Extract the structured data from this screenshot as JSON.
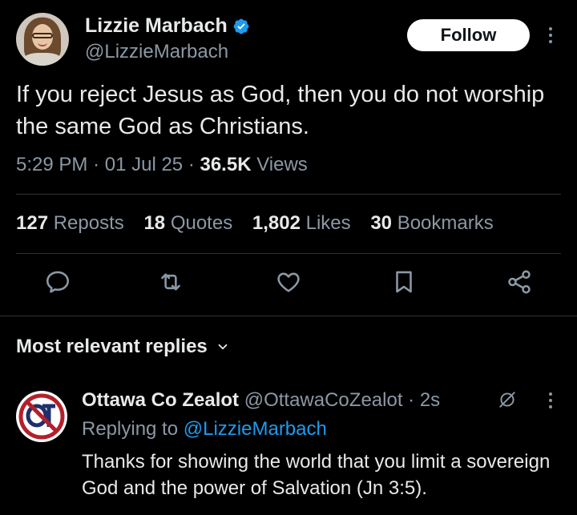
{
  "tweet": {
    "author_name": "Lizzie Marbach",
    "author_handle": "@LizzieMarbach",
    "follow_label": "Follow",
    "text": "If you reject Jesus as God, then you do not worship the same God as Christians.",
    "time": "5:29 PM",
    "date": "01 Jul 25",
    "views_count": "36.5K",
    "views_label": "Views"
  },
  "stats": {
    "reposts_count": "127",
    "reposts_label": "Reposts",
    "quotes_count": "18",
    "quotes_label": "Quotes",
    "likes_count": "1,802",
    "likes_label": "Likes",
    "bookmarks_count": "30",
    "bookmarks_label": "Bookmarks"
  },
  "icons": {
    "verified": "verified-badge-icon",
    "more": "more-vertical-icon",
    "actions": [
      "reply-icon",
      "repost-icon",
      "like-icon",
      "bookmark-icon",
      "share-icon"
    ],
    "dropdown": "chevron-down-icon",
    "grok": "grok-icon"
  },
  "replies": {
    "sort_label": "Most relevant replies",
    "items": [
      {
        "name": "Ottawa Co Zealot",
        "handle": "@OttawaCoZealot",
        "time": "· 2s",
        "replying_prefix": "Replying to",
        "replying_to": "@LizzieMarbach",
        "text": "Thanks for showing the world that you limit a sovereign God and the power of Salvation (Jn 3:5)."
      }
    ]
  },
  "colors": {
    "background": "#000000",
    "text_primary": "#e7e9ea",
    "text_secondary": "#8b98a5",
    "accent": "#1d9bf0",
    "divider": "#2f3336",
    "follow_bg": "#ffffff"
  }
}
